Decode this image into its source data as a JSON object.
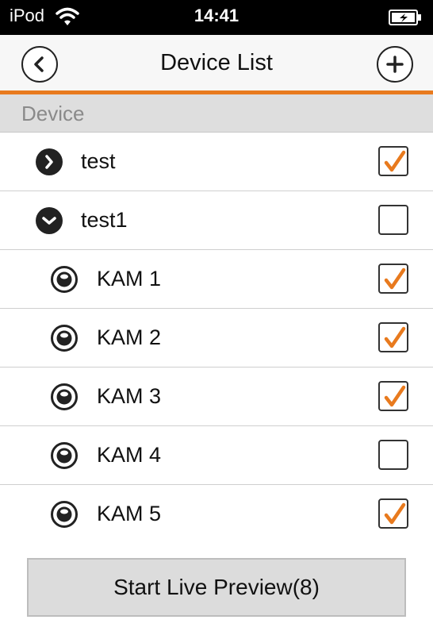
{
  "status_bar": {
    "carrier": "iPod",
    "time": "14:41"
  },
  "nav": {
    "title": "Device List"
  },
  "section": {
    "label": "Device"
  },
  "devices": [
    {
      "label": "test",
      "type": "group",
      "expanded": false,
      "checked": true
    },
    {
      "label": "test1",
      "type": "group",
      "expanded": true,
      "checked": false
    },
    {
      "label": "KAM 1",
      "type": "camera",
      "checked": true
    },
    {
      "label": "KAM 2",
      "type": "camera",
      "checked": true
    },
    {
      "label": "KAM 3",
      "type": "camera",
      "checked": true
    },
    {
      "label": "KAM 4",
      "type": "camera",
      "checked": false
    },
    {
      "label": "KAM 5",
      "type": "camera",
      "checked": true
    }
  ],
  "footer": {
    "start_label": "Start Live Preview(8)"
  },
  "colors": {
    "accent": "#e87a1e",
    "status_bar": "#000000",
    "section_bg": "#dedede"
  },
  "icons": {
    "back": "chevron-left-icon",
    "add": "plus-icon",
    "collapsed": "chevron-right-circle-icon",
    "expanded": "chevron-down-circle-icon",
    "camera": "camera-lens-icon",
    "check": "checkmark-icon"
  }
}
